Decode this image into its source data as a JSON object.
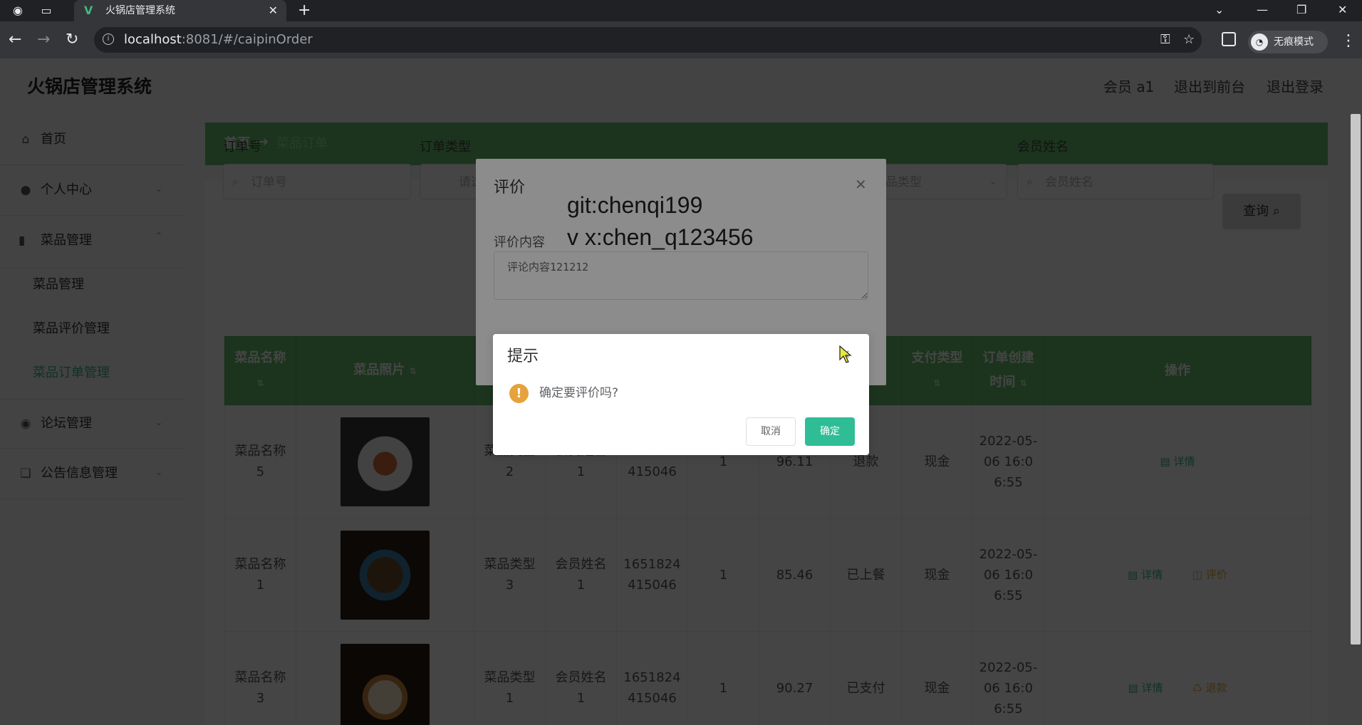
{
  "browser": {
    "tab_title": "火锅店管理系统",
    "url_host": "localhost",
    "url_rest": ":8081/#/caipinOrder",
    "incognito_label": "无痕模式",
    "icons": [
      "back-icon",
      "forward-icon",
      "reload-icon",
      "info-icon",
      "key-icon",
      "star-icon",
      "extension-icon",
      "incognito-icon",
      "menu-icon"
    ]
  },
  "header": {
    "logo": "火锅店管理系统",
    "member": "会员 a1",
    "to_front": "退出到前台",
    "logout": "退出登录"
  },
  "sidebar": {
    "home": "首页",
    "personal": "个人中心",
    "dish_mgmt": "菜品管理",
    "sub": [
      "菜品管理",
      "菜品评价管理",
      "菜品订单管理"
    ],
    "forum": "论坛管理",
    "notice": "公告信息管理"
  },
  "breadcrumb": {
    "home": "首页",
    "arrow": "→",
    "current": "菜品订单"
  },
  "filters": {
    "order_no_label": "订单号",
    "order_no_ph": "订单号",
    "order_type_label": "订单类型",
    "order_type_ph": "请选择",
    "dish_type_ph": "品类型",
    "member_name_label": "会员姓名",
    "member_name_ph": "会员姓名",
    "query": "查询"
  },
  "table": {
    "headers": [
      "菜品名称",
      "菜品照片",
      "",
      "",
      "",
      "",
      "",
      "",
      "支付类型",
      "订单创建时间",
      "操作"
    ],
    "rows": [
      {
        "name": "菜品名称5",
        "type": "菜品类型2",
        "member": "会员姓名1",
        "order": "1651824415046",
        "qty": "1",
        "price": "96.11",
        "status": "退款",
        "pay": "现金",
        "time": "2022-05-06 16:06:55",
        "ops": [
          "详情"
        ]
      },
      {
        "name": "菜品名称1",
        "type": "菜品类型3",
        "member": "会员姓名1",
        "order": "1651824415046",
        "qty": "1",
        "price": "85.46",
        "status": "已上餐",
        "pay": "现金",
        "time": "2022-05-06 16:06:55",
        "ops": [
          "详情",
          "评价"
        ]
      },
      {
        "name": "菜品名称3",
        "type": "菜品类型1",
        "member": "会员姓名1",
        "order": "1651824415046",
        "qty": "1",
        "price": "90.27",
        "status": "已支付",
        "pay": "现金",
        "time": "2022-05-06 16:06:55",
        "ops": [
          "详情",
          "退款"
        ]
      }
    ]
  },
  "eval_dialog": {
    "title": "评价",
    "field_label": "评价内容",
    "content": "评论内容121212",
    "watermark_1": "git:chenqi199",
    "watermark_2": "v x:chen_q123456"
  },
  "confirm": {
    "title": "提示",
    "message": "确定要评价吗?",
    "cancel": "取消",
    "ok": "确定"
  }
}
